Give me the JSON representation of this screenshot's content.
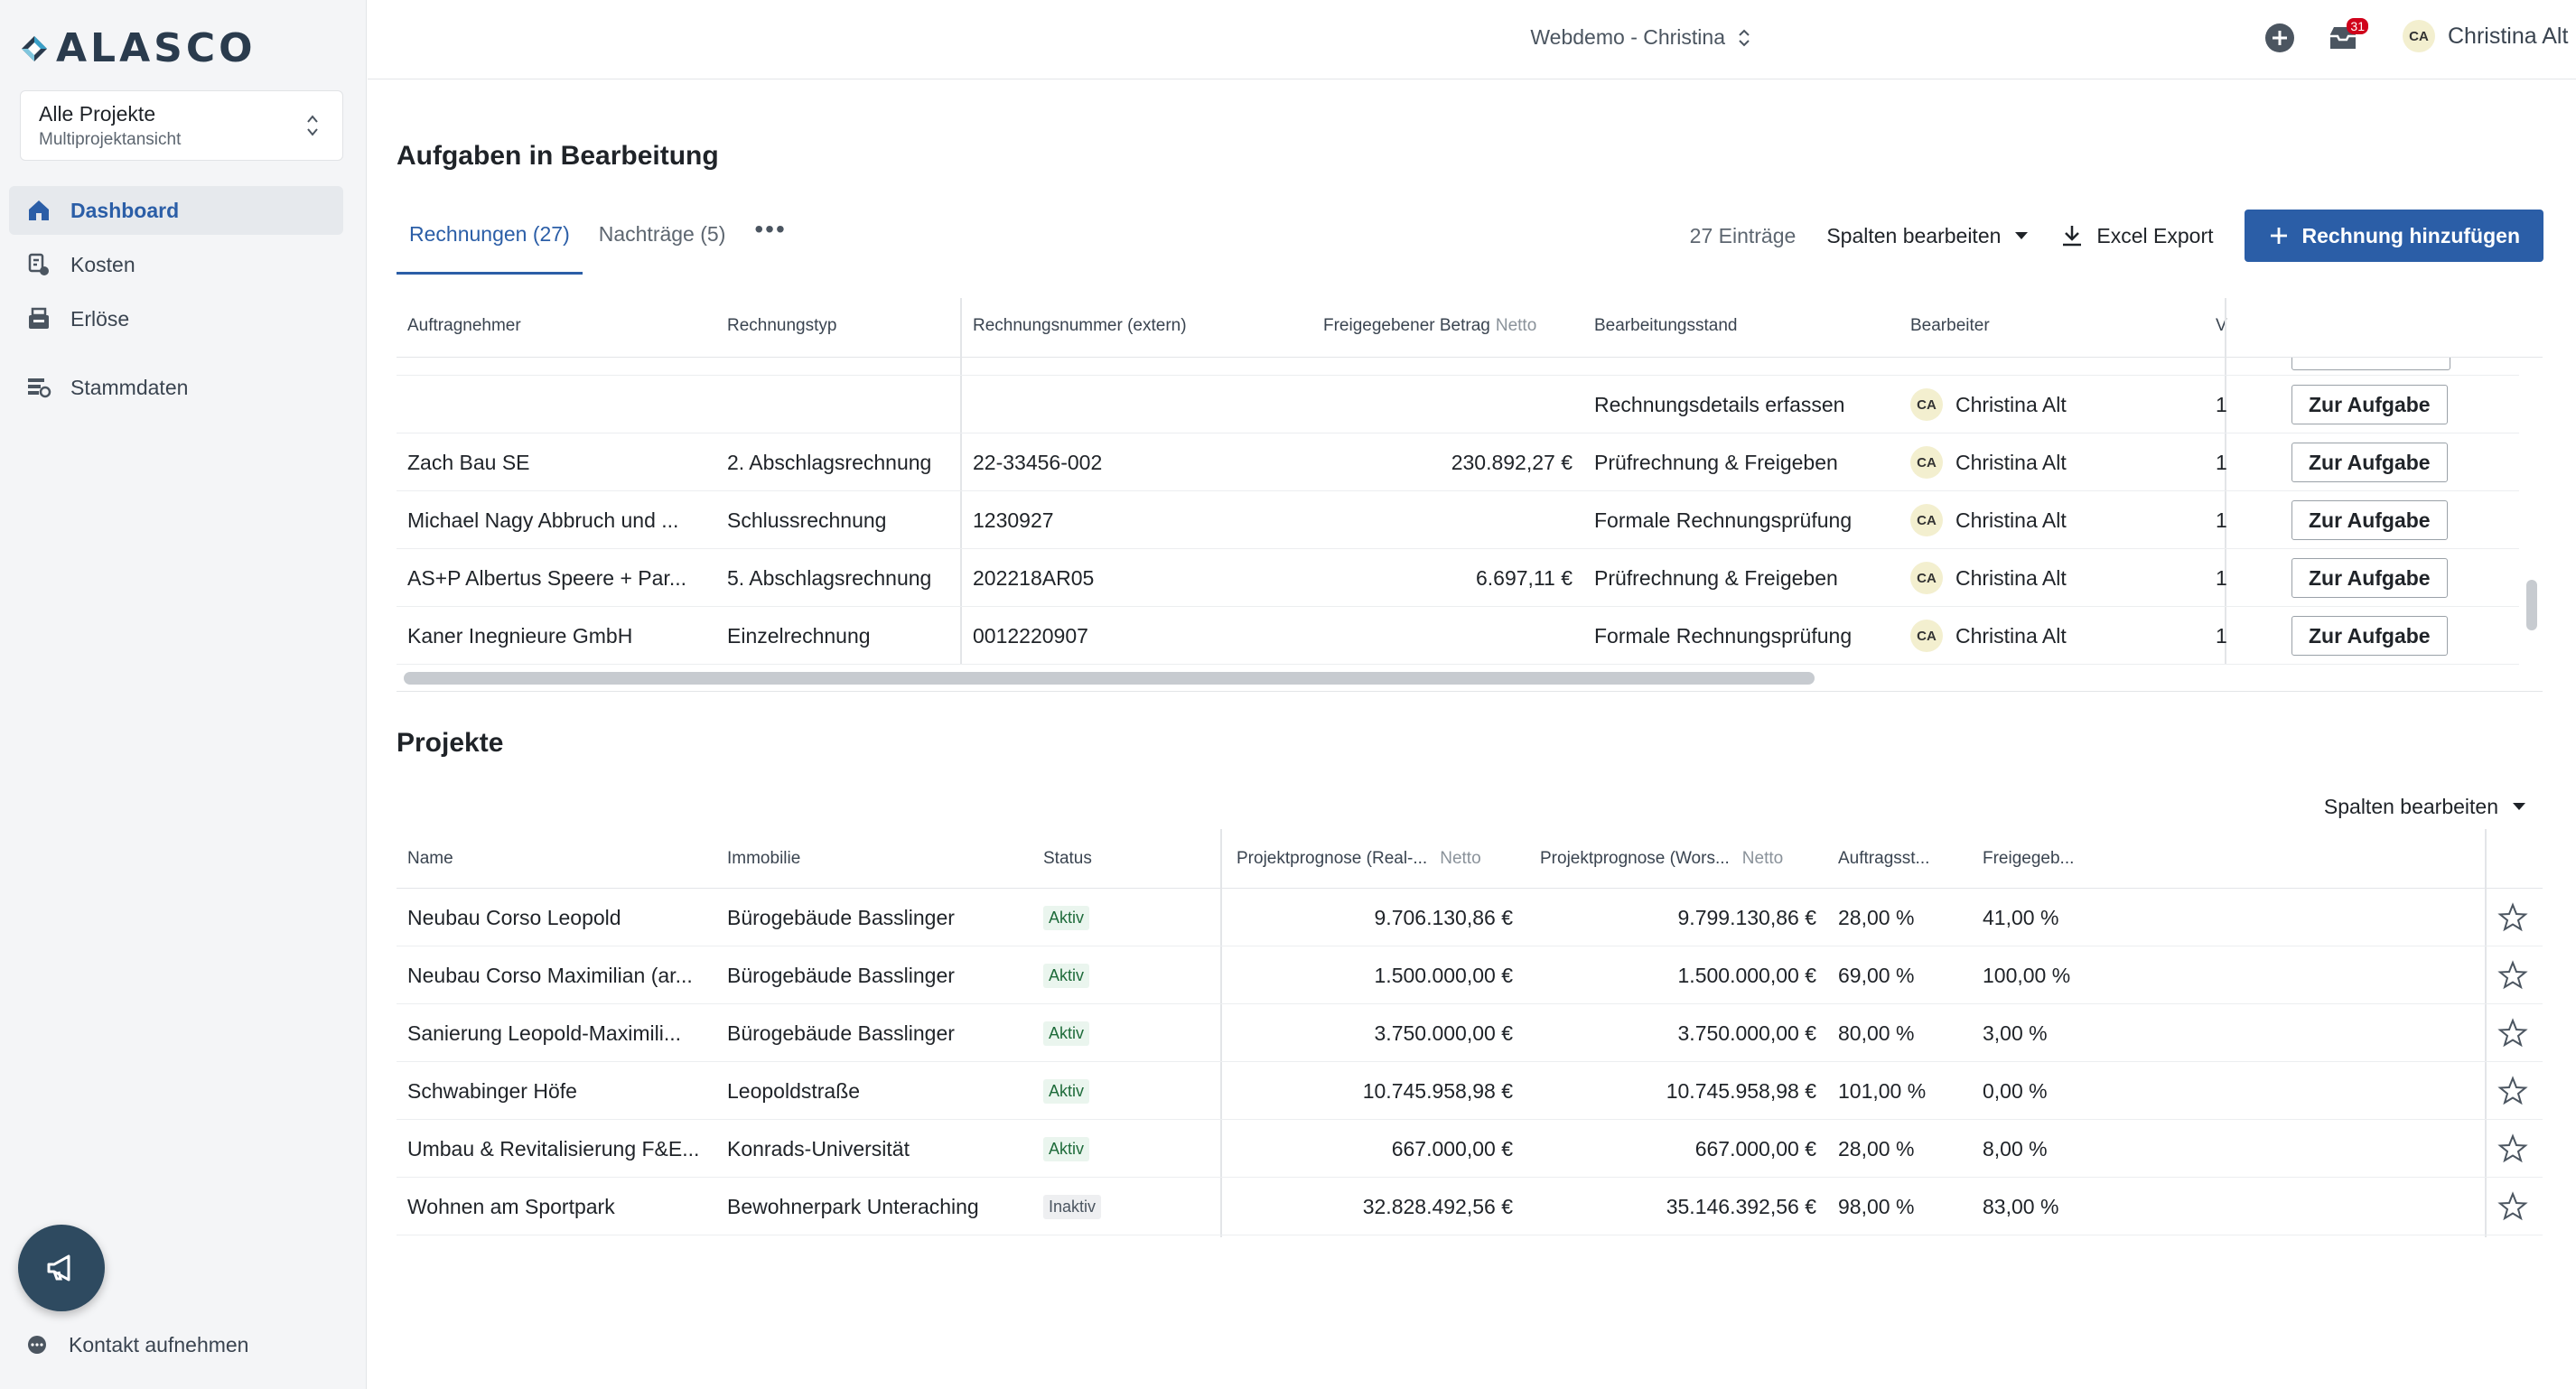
{
  "app": {
    "logo_text": "ALASCO",
    "project_selector": {
      "title": "Alle Projekte",
      "subtitle": "Multiprojektansicht"
    },
    "nav": [
      {
        "label": "Dashboard",
        "icon": "home-icon"
      },
      {
        "label": "Kosten",
        "icon": "costs-icon"
      },
      {
        "label": "Erlöse",
        "icon": "revenue-icon"
      },
      {
        "label": "Stammdaten",
        "icon": "masterdata-icon"
      }
    ],
    "contact_label": "Kontakt aufnehmen"
  },
  "topbar": {
    "tenant": "Webdemo - Christina",
    "notifications_count": "31",
    "user_initials": "CA",
    "user_name": "Christina Alt"
  },
  "tasks": {
    "title": "Aufgaben in Bearbeitung",
    "tabs": [
      "Rechnungen (27)",
      "Nachträge (5)"
    ],
    "entries": "27 Einträge",
    "edit_columns": "Spalten bearbeiten",
    "excel_export": "Excel Export",
    "add_invoice": "Rechnung hinzufügen",
    "columns": {
      "contractor": "Auftragnehmer",
      "type": "Rechnungstyp",
      "number": "Rechnungsnummer (extern)",
      "amount": "Freigegebener Betrag",
      "amount_suffix": "Netto",
      "state": "Bearbeitungsstand",
      "assignee": "Bearbeiter",
      "extra": "V"
    },
    "rows": [
      {
        "contractor": "",
        "type": "",
        "number": "",
        "amount": "",
        "state": "Rechnungsdetails erfassen",
        "initials": "CA",
        "assignee": "Christina Alt",
        "extra": "1",
        "action": "Zur Aufgabe"
      },
      {
        "contractor": "Zach Bau SE",
        "type": "2. Abschlagsrechnung",
        "number": "22-33456-002",
        "amount": "230.892,27 €",
        "state": "Prüfrechnung & Freigeben",
        "initials": "CA",
        "assignee": "Christina Alt",
        "extra": "1",
        "action": "Zur Aufgabe"
      },
      {
        "contractor": "Michael Nagy Abbruch und ...",
        "type": "Schlussrechnung",
        "number": "1230927",
        "amount": "",
        "state": "Formale Rechnungsprüfung",
        "initials": "CA",
        "assignee": "Christina Alt",
        "extra": "1",
        "action": "Zur Aufgabe"
      },
      {
        "contractor": "AS+P Albertus Speere + Par...",
        "type": "5. Abschlagsrechnung",
        "number": "202218AR05",
        "amount": "6.697,11 €",
        "state": "Prüfrechnung & Freigeben",
        "initials": "CA",
        "assignee": "Christina Alt",
        "extra": "1",
        "action": "Zur Aufgabe"
      },
      {
        "contractor": "Kaner Inegnieure GmbH",
        "type": "Einzelrechnung",
        "number": "0012220907",
        "amount": "",
        "state": "Formale Rechnungsprüfung",
        "initials": "CA",
        "assignee": "Christina Alt",
        "extra": "1",
        "action": "Zur Aufgabe"
      }
    ]
  },
  "projects": {
    "title": "Projekte",
    "edit_columns": "Spalten bearbeiten",
    "columns": {
      "name": "Name",
      "property": "Immobilie",
      "status": "Status",
      "forecast_real": "Projektprognose (Real-...",
      "forecast_worst": "Projektprognose (Wors...",
      "netto": "Netto",
      "order_status": "Auftragsst...",
      "released": "Freigegeb..."
    },
    "rows": [
      {
        "name": "Neubau Corso Leopold",
        "property": "Bürogebäude Basslinger",
        "status": "Aktiv",
        "forecast_real": "9.706.130,86 €",
        "forecast_worst": "9.799.130,86 €",
        "order_status": "28,00 %",
        "released": "41,00 %"
      },
      {
        "name": "Neubau Corso Maximilian (ar...",
        "property": "Bürogebäude Basslinger",
        "status": "Aktiv",
        "forecast_real": "1.500.000,00 €",
        "forecast_worst": "1.500.000,00 €",
        "order_status": "69,00 %",
        "released": "100,00 %"
      },
      {
        "name": "Sanierung Leopold-Maximili...",
        "property": "Bürogebäude Basslinger",
        "status": "Aktiv",
        "forecast_real": "3.750.000,00 €",
        "forecast_worst": "3.750.000,00 €",
        "order_status": "80,00 %",
        "released": "3,00 %"
      },
      {
        "name": "Schwabinger Höfe",
        "property": "Leopoldstraße",
        "status": "Aktiv",
        "forecast_real": "10.745.958,98 €",
        "forecast_worst": "10.745.958,98 €",
        "order_status": "101,00 %",
        "released": "0,00 %"
      },
      {
        "name": "Umbau & Revitalisierung F&E...",
        "property": "Konrads-Universität",
        "status": "Aktiv",
        "forecast_real": "667.000,00 €",
        "forecast_worst": "667.000,00 €",
        "order_status": "28,00 %",
        "released": "8,00 %"
      },
      {
        "name": "Wohnen am Sportpark",
        "property": "Bewohnerpark Unteraching",
        "status": "Inaktiv",
        "forecast_real": "32.828.492,56 €",
        "forecast_worst": "35.146.392,56 €",
        "order_status": "98,00 %",
        "released": "83,00 %"
      }
    ]
  },
  "colors": {
    "primary": "#2b5ea7",
    "sidebar_bg": "#f4f5f7",
    "fab": "#2e4a60",
    "badge": "#d0021b"
  }
}
